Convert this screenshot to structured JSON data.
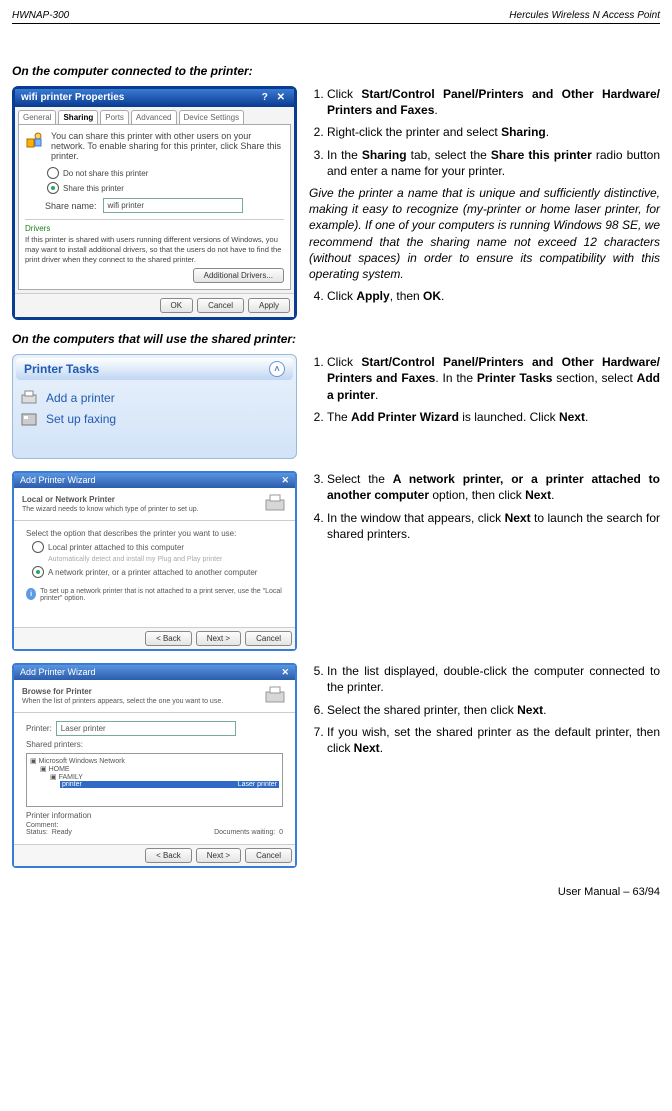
{
  "header": {
    "left": "HWNAP-300",
    "right": "Hercules Wireless N Access Point"
  },
  "sec1": {
    "title": "On the computer connected to the printer:",
    "dialog": {
      "title": "wifi printer Properties",
      "tabs": [
        "General",
        "Sharing",
        "Ports",
        "Advanced",
        "Device Settings"
      ],
      "info": "You can share this printer with other users on your network. To enable sharing for this printer, click Share this printer.",
      "radio1": "Do not share this printer",
      "radio2": "Share this printer",
      "share_label": "Share name:",
      "share_value": "wifi printer",
      "drivers_word": "Drivers",
      "drivers_text": "If this printer is shared with users running different versions of Windows, you may want to install additional drivers, so that the users do not have to find the print driver when they connect to the shared printer.",
      "btn_add": "Additional Drivers...",
      "ok": "OK",
      "cancel": "Cancel",
      "apply": "Apply"
    },
    "steps": {
      "s1a": "Click ",
      "s1b": "Start/Control Panel/Printers and Other Hardware/ Printers and Faxes",
      "s1c": ".",
      "s2a": "Right-click the printer and select ",
      "s2b": "Sharing",
      "s2c": ".",
      "s3a": "In the ",
      "s3b": "Sharing",
      "s3c": " tab, select the ",
      "s3d": "Share this printer",
      "s3e": " radio button and enter a name for your printer.",
      "note": "Give the printer a name that is unique and sufficiently distinctive, making it easy to recognize (my-printer or home laser printer, for example).  If one of your computers is running Windows 98 SE, we recommend that the sharing name not exceed 12 characters (without spaces) in order to ensure its compatibility with this operating system.",
      "s4a": "Click ",
      "s4b": "Apply",
      "s4c": ", then ",
      "s4d": "OK",
      "s4e": "."
    }
  },
  "sec2": {
    "title": "On the computers that will use the shared printer:",
    "task_panel": {
      "title": "Printer Tasks",
      "item1": "Add a printer",
      "item2": "Set up faxing"
    },
    "wizard": {
      "title": "Add Printer Wizard",
      "head1a": "Local or Network Printer",
      "head1b": "The wizard needs to know which type of printer to set up.",
      "body1a": "Select the option that describes the printer you want to use:",
      "opt1": "Local printer attached to this computer",
      "opt1sub": "Automatically detect and install my Plug and Play printer",
      "opt2": "A network printer, or a printer attached to another computer",
      "hint": "To set up a network printer that is not attached to a print server, use the \"Local printer\" option.",
      "back": "< Back",
      "next": "Next >",
      "cancel": "Cancel",
      "head2a": "Browse for Printer",
      "head2b": "When the list of printers appears, select the one you want to use.",
      "printer_lbl": "Printer:",
      "printer_val": "Laser printer",
      "shared_lbl": "Shared printers:",
      "tree1": "Microsoft Windows Network",
      "tree2": "HOME",
      "tree3": "FAMILY",
      "tree4": "printer",
      "tree4b": "Laser printer",
      "info_lbl": "Printer information",
      "comment": "Comment:",
      "status": "Status:",
      "status_v": "Ready",
      "docs": "Documents waiting:",
      "docs_v": "0"
    },
    "steps": {
      "s1a": "Click ",
      "s1b": "Start/Control Panel/Printers and Other Hardware/ Printers and Faxes",
      "s1c": ".  In the ",
      "s1d": "Printer Tasks",
      "s1e": " section, select ",
      "s1f": "Add a printer",
      "s1g": ".",
      "s2a": "The ",
      "s2b": "Add Printer Wizard",
      "s2c": " is launched.  Click ",
      "s2d": "Next",
      "s2e": ".",
      "s3a": "Select the ",
      "s3b": "A network printer, or a printer attached to another computer",
      "s3c": " option, then click ",
      "s3d": "Next",
      "s3e": ".",
      "s4a": "In the window that appears, click ",
      "s4b": "Next",
      "s4c": " to launch the search for shared printers.",
      "s5": "In the list displayed, double-click the computer connected to the printer.",
      "s6a": "Select the shared printer, then click ",
      "s6b": "Next",
      "s6c": ".",
      "s7a": "If you wish, set the shared printer as the default printer, then click ",
      "s7b": "Next",
      "s7c": "."
    }
  },
  "footer": "User Manual – 63/94"
}
